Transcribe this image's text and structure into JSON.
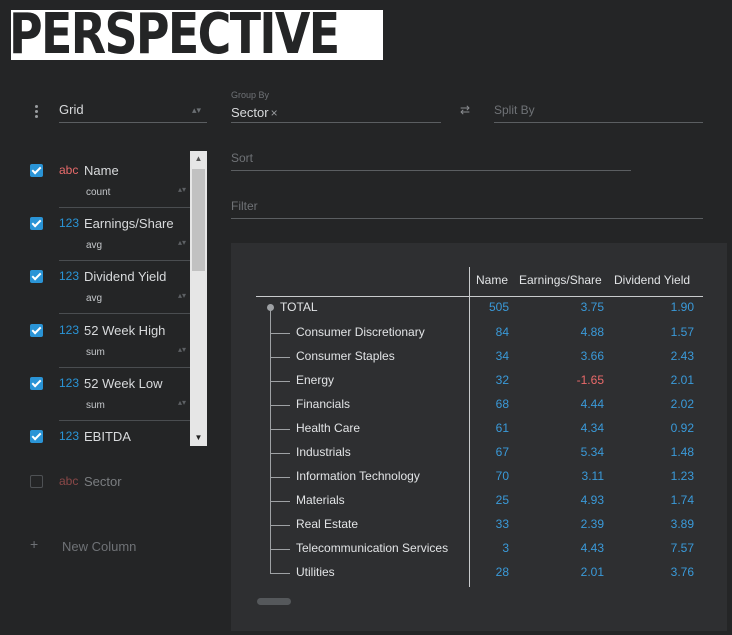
{
  "logo": {
    "text": "PERSPECTIVE"
  },
  "plugin": {
    "selected": "Grid"
  },
  "columns": [
    {
      "type": "abc",
      "kind": "str",
      "name": "Name",
      "aggregate": "count",
      "checked": true
    },
    {
      "type": "123",
      "kind": "num",
      "name": "Earnings/Share",
      "aggregate": "avg",
      "checked": true
    },
    {
      "type": "123",
      "kind": "num",
      "name": "Dividend Yield",
      "aggregate": "avg",
      "checked": true
    },
    {
      "type": "123",
      "kind": "num",
      "name": "52 Week High",
      "aggregate": "sum",
      "checked": true
    },
    {
      "type": "123",
      "kind": "num",
      "name": "52 Week Low",
      "aggregate": "sum",
      "checked": true
    },
    {
      "type": "123",
      "kind": "num",
      "name": "EBITDA",
      "aggregate": "",
      "checked": true
    }
  ],
  "inactive_columns": [
    {
      "type": "abc",
      "name": "Sector",
      "checked": false
    }
  ],
  "new_column_label": "New Column",
  "group_by": {
    "label": "Group By",
    "value": "Sector",
    "remove": "×"
  },
  "split_by": {
    "placeholder": "Split By"
  },
  "swap_icon": "⇄",
  "sort": {
    "placeholder": "Sort"
  },
  "filter": {
    "placeholder": "Filter"
  },
  "grid": {
    "headers": [
      "Name",
      "Earnings/Share",
      "Dividend Yield"
    ],
    "total": {
      "label": "TOTAL",
      "values": [
        "505",
        "3.75",
        "1.90"
      ]
    },
    "rows": [
      {
        "label": "Consumer Discretionary",
        "values": [
          "84",
          "4.88",
          "1.57"
        ]
      },
      {
        "label": "Consumer Staples",
        "values": [
          "34",
          "3.66",
          "2.43"
        ]
      },
      {
        "label": "Energy",
        "values": [
          "32",
          "-1.65",
          "2.01"
        ]
      },
      {
        "label": "Financials",
        "values": [
          "68",
          "4.44",
          "2.02"
        ]
      },
      {
        "label": "Health Care",
        "values": [
          "61",
          "4.34",
          "0.92"
        ]
      },
      {
        "label": "Industrials",
        "values": [
          "67",
          "5.34",
          "1.48"
        ]
      },
      {
        "label": "Information Technology",
        "values": [
          "70",
          "3.11",
          "1.23"
        ]
      },
      {
        "label": "Materials",
        "values": [
          "25",
          "4.93",
          "1.74"
        ]
      },
      {
        "label": "Real Estate",
        "values": [
          "33",
          "2.39",
          "3.89"
        ]
      },
      {
        "label": "Telecommunication Services",
        "values": [
          "3",
          "4.43",
          "7.57"
        ]
      },
      {
        "label": "Utilities",
        "values": [
          "28",
          "2.01",
          "3.76"
        ]
      }
    ]
  },
  "colors": {
    "accent": "#2a94d6",
    "negative": "#e96a6a",
    "string_type": "#e86b6b",
    "background": "#242526"
  }
}
